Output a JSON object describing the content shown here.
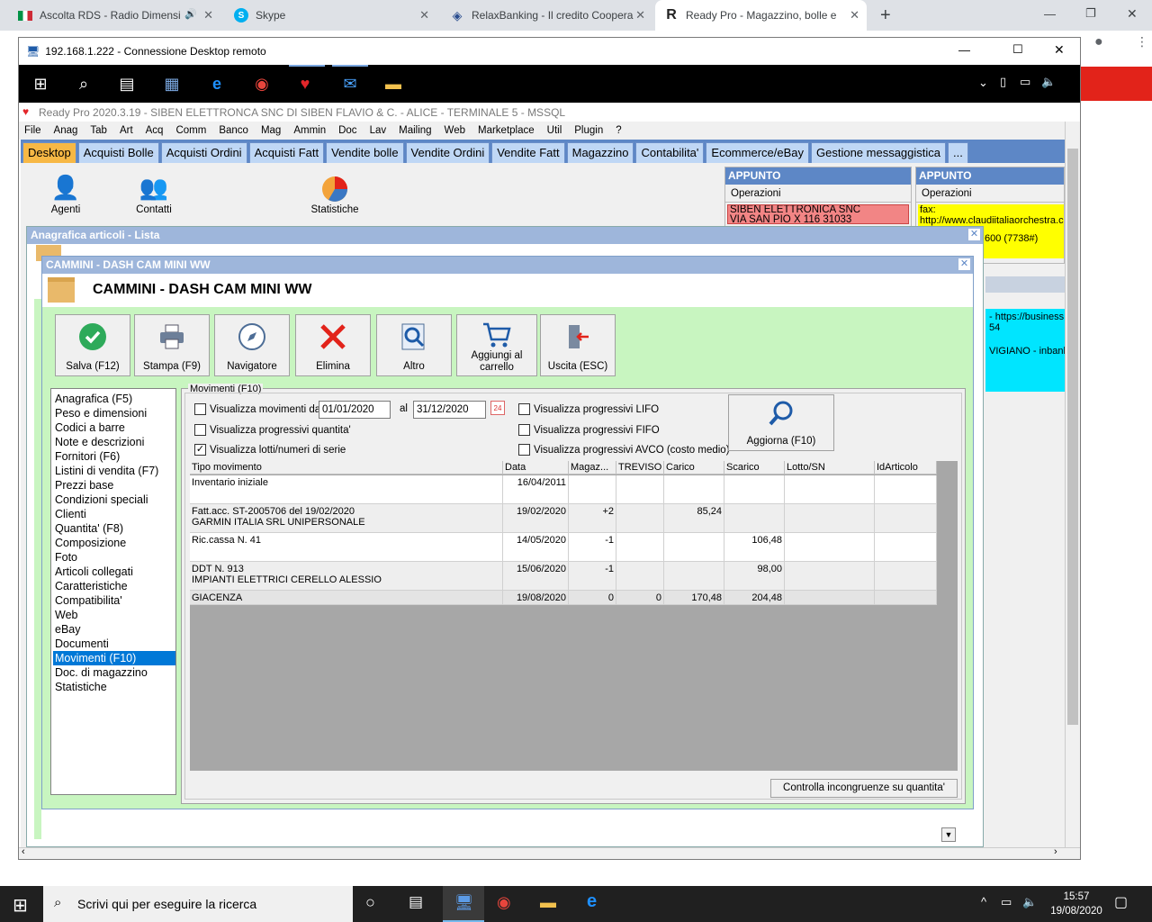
{
  "browser": {
    "tabs": [
      {
        "title": "Ascolta RDS - Radio Dimensi"
      },
      {
        "title": "Skype"
      },
      {
        "title": "RelaxBanking - Il credito Coopera"
      },
      {
        "title": "Ready Pro - Magazzino, bolle e"
      }
    ],
    "new_tab": "+"
  },
  "rdp": {
    "title": "192.168.1.222 - Connessione Desktop remoto"
  },
  "app": {
    "title": "Ready Pro 2020.3.19 - SIBEN ELETTRONCA SNC DI SIBEN FLAVIO & C. - ALICE - TERMINALE 5 - MSSQL",
    "menu": [
      "File",
      "Anag",
      "Tab",
      "Art",
      "Acq",
      "Comm",
      "Banco",
      "Mag",
      "Ammin",
      "Doc",
      "Lav",
      "Mailing",
      "Web",
      "Marketplace",
      "Util",
      "Plugin",
      "?"
    ],
    "module_tabs": [
      "Desktop",
      "Acquisti Bolle",
      "Acquisti Ordini",
      "Acquisti Fatt",
      "Vendite bolle",
      "Vendite Ordini",
      "Vendite Fatt",
      "Magazzino",
      "Contabilita'",
      "Ecommerce/eBay",
      "Gestione messaggistica",
      "..."
    ],
    "desktop_icons": [
      "Agenti",
      "Contatti",
      "Statistiche"
    ],
    "appunto1": {
      "title": "APPUNTO",
      "ops": "Operazioni",
      "line1": "SIBEN ELETTRONICA SNC",
      "line2": "VIA SAN PIO X 116  31033"
    },
    "appunto2": {
      "title": "APPUNTO",
      "ops": "Operazioni",
      "line1": "fax:",
      "line2": "http://www.claudiitaliaorchestra.c",
      "line3": "600 (7738#)"
    },
    "appunto3": {
      "line1": "- https://business.",
      "line2": "54",
      "line3": "VIGIANO - inbank."
    }
  },
  "list_window": {
    "title": "Anagrafica articoli  - Lista"
  },
  "detail": {
    "window_title": "CAMMINI - DASH CAM MINI WW",
    "heading": "CAMMINI - DASH CAM MINI WW",
    "buttons": [
      "Salva (F12)",
      "Stampa (F9)",
      "Navigatore",
      "Elimina",
      "Altro",
      "Aggiungi al carrello",
      "Uscita (ESC)"
    ],
    "sections": [
      "Anagrafica (F5)",
      "Peso e dimensioni",
      "Codici a barre",
      "Note e descrizioni",
      "Fornitori (F6)",
      "Listini di vendita (F7)",
      "Prezzi base",
      "Condizioni speciali",
      "Clienti",
      "Quantita' (F8)",
      "Composizione",
      "Foto",
      "Articoli collegati",
      "Caratteristiche",
      "Compatibilita'",
      "Web",
      "eBay",
      "Documenti",
      "Movimenti (F10)",
      "Doc. di magazzino",
      "Statistiche"
    ],
    "selected_section": "Movimenti (F10)",
    "movimenti": {
      "group_label": "Movimenti (F10)",
      "chk_dal": "Visualizza movimenti dal",
      "date_from": "01/01/2020",
      "al": "al",
      "date_to": "31/12/2020",
      "chk_prog_qty": "Visualizza progressivi quantita'",
      "chk_lotti": "Visualizza lotti/numeri di serie",
      "chk_lifo": "Visualizza progressivi LIFO",
      "chk_fifo": "Visualizza progressivi FIFO",
      "chk_avco": "Visualizza progressivi AVCO (costo medio)",
      "refresh": "Aggiorna (F10)",
      "check_button": "Controlla incongruenze su quantita'",
      "columns": [
        "Tipo movimento",
        "Data",
        "Magaz...",
        "TREVISO",
        "Carico",
        "Scarico",
        "Lotto/SN",
        "IdArticolo"
      ],
      "rows": [
        {
          "tipo1": "Inventario iniziale",
          "tipo2": "",
          "data": "16/04/2011",
          "mag": "",
          "treviso": "",
          "carico": "",
          "scarico": ""
        },
        {
          "tipo1": "Fatt.acc. ST-2005706 del 19/02/2020",
          "tipo2": "GARMIN ITALIA SRL UNIPERSONALE",
          "data": "19/02/2020",
          "mag": "+2",
          "treviso": "",
          "carico": "85,24",
          "scarico": ""
        },
        {
          "tipo1": "Ric.cassa N. 41",
          "tipo2": "",
          "data": "14/05/2020",
          "mag": "-1",
          "treviso": "",
          "carico": "",
          "scarico": "106,48"
        },
        {
          "tipo1": "DDT N. 913",
          "tipo2": "IMPIANTI ELETTRICI CERELLO ALESSIO",
          "data": "15/06/2020",
          "mag": "-1",
          "treviso": "",
          "carico": "",
          "scarico": "98,00"
        }
      ],
      "total": {
        "tipo": "GIACENZA",
        "data": "19/08/2020",
        "mag": "0",
        "treviso": "0",
        "carico": "170,48",
        "scarico": "204,48"
      }
    }
  },
  "taskbar": {
    "search_placeholder": "Scrivi qui per eseguire la ricerca",
    "time": "15:57",
    "date": "19/08/2020"
  },
  "colors": {
    "accent": "#5d87c6",
    "tab_selected": "#f7b845",
    "form_bg": "#c8f5c0",
    "selection": "#0078d7"
  }
}
